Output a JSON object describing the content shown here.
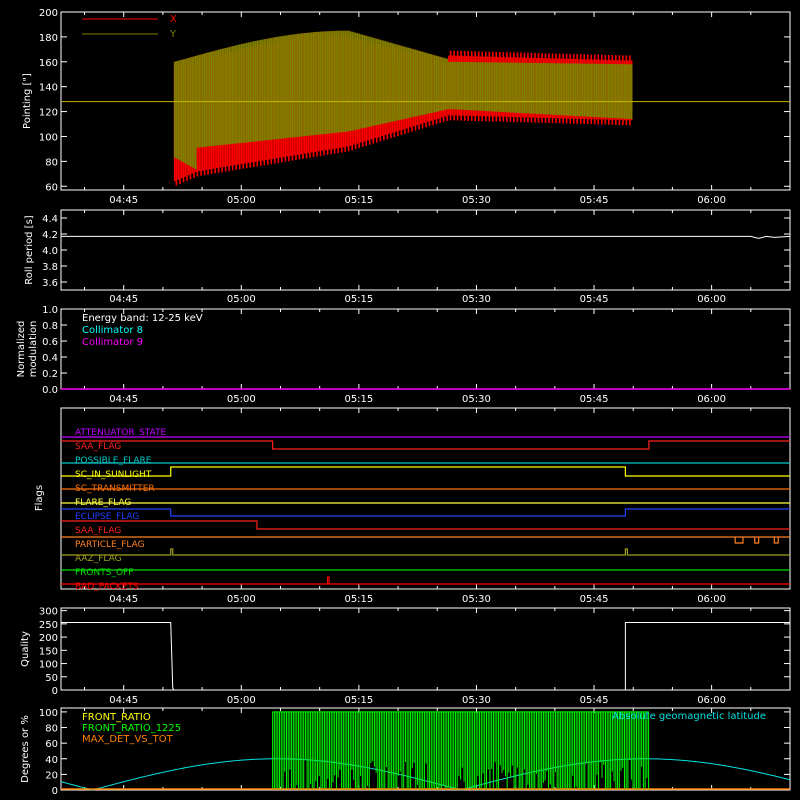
{
  "time_ticks": [
    "04:45",
    "05:00",
    "05:15",
    "05:30",
    "05:45",
    "06:00"
  ],
  "time_range": [
    "04:37",
    "06:10"
  ],
  "panels": {
    "pointing": {
      "ylabel": "Pointing [\"]",
      "ylim": [
        57,
        200
      ],
      "yticks": [
        60,
        80,
        100,
        120,
        140,
        160,
        180,
        200
      ],
      "legend": [
        {
          "name": "X",
          "color": "#ff0000"
        },
        {
          "name": "Y",
          "color": "#808000"
        }
      ],
      "reference_line": 128,
      "colors": {
        "x": "#ff0000",
        "y": "#808000",
        "ref": "#c8b400"
      }
    },
    "roll": {
      "ylabel": "Roll period [s]",
      "ylim": [
        3.5,
        4.5
      ],
      "yticks": [
        "3.6",
        "3.8",
        "4.0",
        "4.2",
        "4.4"
      ],
      "value": 4.17
    },
    "modulation": {
      "ylabel_1": "Normalized",
      "ylabel_2": "modulation",
      "ylim": [
        0,
        1
      ],
      "yticks": [
        "0.0",
        "0.2",
        "0.4",
        "0.6",
        "0.8",
        "1.0"
      ],
      "legend": [
        {
          "name": "Energy band: 12-25 keV",
          "color": "#ffffff"
        },
        {
          "name": "Collimator 8",
          "color": "#00ffff"
        },
        {
          "name": "Collimator 9",
          "color": "#ff00ff"
        }
      ]
    },
    "flags": {
      "ylabel": "Flags",
      "items": [
        {
          "name": "ATTENUATOR_STATE",
          "color": "#c000ff"
        },
        {
          "name": "SAA_FLAG",
          "color": "#ff2020"
        },
        {
          "name": "POSSIBLE_FLARE",
          "color": "#00c8c8"
        },
        {
          "name": "SC_IN_SUNLIGHT",
          "color": "#ffff00"
        },
        {
          "name": "SC_TRANSMITTER",
          "color": "#ff7000"
        },
        {
          "name": "FLARE_FLAG",
          "color": "#ffff40"
        },
        {
          "name": "ECLIPSE_FLAG",
          "color": "#2040ff"
        },
        {
          "name": "SAA_FLAG",
          "color": "#ff2020"
        },
        {
          "name": "PARTICLE_FLAG",
          "color": "#ff8020"
        },
        {
          "name": "AAZ_FLAG",
          "color": "#a0a020"
        },
        {
          "name": "FRONTS_OFF",
          "color": "#00e000"
        },
        {
          "name": "BAD_PACKETS",
          "color": "#ff0000"
        }
      ]
    },
    "quality": {
      "ylabel": "Quality",
      "ylim": [
        0,
        310
      ],
      "yticks": [
        "0",
        "50",
        "100",
        "150",
        "200",
        "250",
        "300"
      ],
      "level": 255
    },
    "geo": {
      "ylabel": "Degrees or %",
      "ylim": [
        0,
        105
      ],
      "yticks": [
        "0",
        "20",
        "40",
        "60",
        "80",
        "100"
      ],
      "legend": [
        {
          "name": "FRONT_RATIO",
          "color": "#ffff00"
        },
        {
          "name": "FRONT_RATIO_1225",
          "color": "#00ff00"
        },
        {
          "name": "MAX_DET_VS_TOT",
          "color": "#ff8000"
        }
      ],
      "latitude_label": "Absolute geomagnetic latitude",
      "latitude_color": "#00e0e0"
    }
  }
}
